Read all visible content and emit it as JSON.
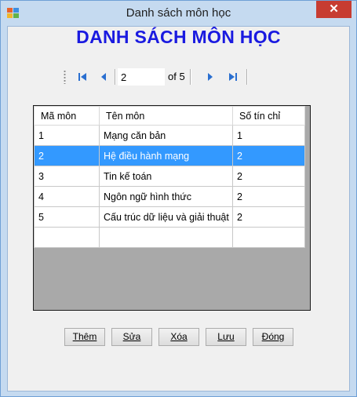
{
  "window": {
    "title": "Danh sách môn học",
    "close_glyph": "✕"
  },
  "heading": "DANH SÁCH MÔN HỌC",
  "navigator": {
    "position": "2",
    "of_label": "of 5"
  },
  "grid": {
    "columns": [
      "Mã môn",
      "Tên môn",
      "Số tín chỉ"
    ],
    "rows": [
      [
        "1",
        "Mạng căn bản",
        "1"
      ],
      [
        "2",
        "Hệ điều hành mạng",
        "2"
      ],
      [
        "3",
        "Tin kế toán",
        "2"
      ],
      [
        "4",
        "Ngôn ngữ hình thức",
        "2"
      ],
      [
        "5",
        "Cấu trúc dữ liệu và giải thuật",
        "2"
      ]
    ],
    "selected_row": 1
  },
  "buttons": {
    "add": "Thêm",
    "edit": "Sửa",
    "delete": "Xóa",
    "save": "Lưu",
    "close": "Đóng"
  },
  "colors": {
    "heading": "#1a1ae0",
    "selection": "#3399ff",
    "close": "#c73c31"
  }
}
